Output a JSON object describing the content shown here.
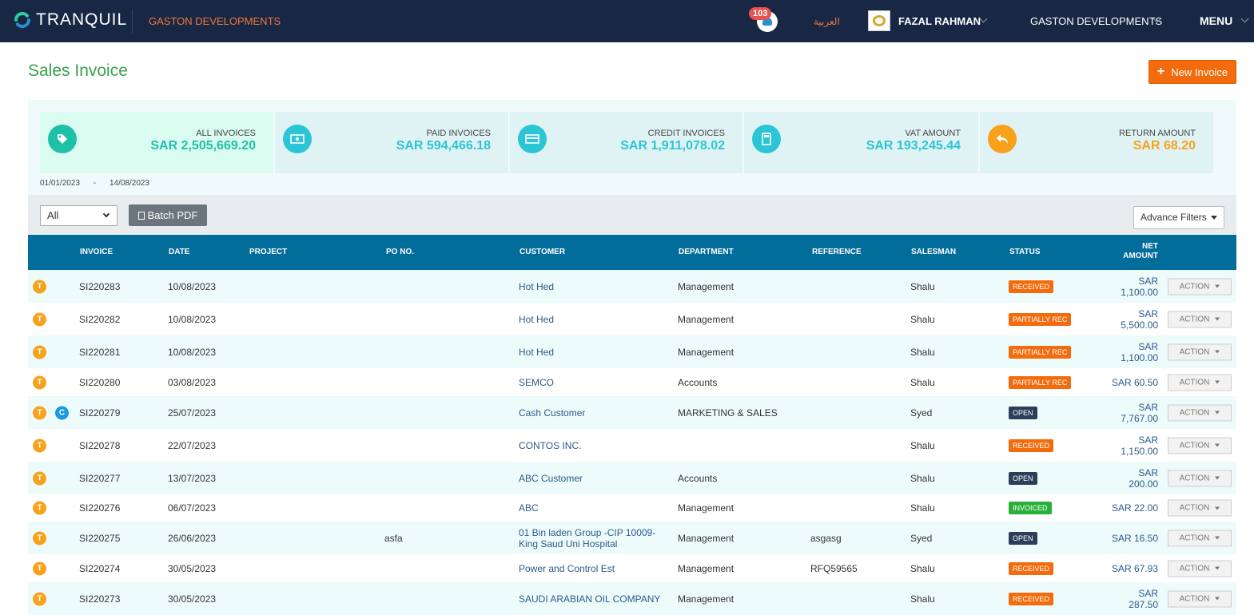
{
  "topbar": {
    "brand": "TRANQUIL",
    "company": "GASTON DEVELOPMENTS",
    "notification_count": "103",
    "language_link": "العربية",
    "user_name": "FAZAL RAHMAN",
    "company_dropdown": "GASTON DEVELOPMENTS",
    "menu": "MENU"
  },
  "page": {
    "title": "Sales Invoice",
    "new_button": "New Invoice"
  },
  "summary": {
    "cards": [
      {
        "label": "ALL INVOICES",
        "value": "SAR 2,505,669.20",
        "icon": "tag-icon",
        "color": "#1fc0a8"
      },
      {
        "label": "PAID INVOICES",
        "value": "SAR 594,466.18",
        "icon": "cash-icon",
        "color": "#2cc5d5"
      },
      {
        "label": "CREDIT INVOICES",
        "value": "SAR 1,911,078.02",
        "icon": "credit-card-icon",
        "color": "#2cc5d5"
      },
      {
        "label": "VAT AMOUNT",
        "value": "SAR 193,245.44",
        "icon": "calculator-icon",
        "color": "#2cc5d5"
      },
      {
        "label": "RETURN AMOUNT",
        "value": "SAR 68.20",
        "icon": "reply-icon",
        "color": "#f7a21a"
      }
    ],
    "date_from": "01/01/2023",
    "date_sep": "-",
    "date_to": "14/08/2023"
  },
  "toolbar": {
    "filter_value": "All",
    "batch_pdf": "Batch PDF",
    "advance_filters": "Advance Filters"
  },
  "table": {
    "headers": {
      "invoice": "INVOICE",
      "date": "DATE",
      "project": "PROJECT",
      "po_no": "PO NO.",
      "customer": "CUSTOMER",
      "department": "DEPARTMENT",
      "reference": "REFERENCE",
      "salesman": "SALESMAN",
      "status": "STATUS",
      "net_amount_1": "NET",
      "net_amount_2": "AMOUNT"
    },
    "action_label": "ACTION",
    "type_badge": "T",
    "cash_badge": "C",
    "rows": [
      {
        "invoice": "SI220283",
        "date": "10/08/2023",
        "project": "",
        "po": "",
        "customer": "Hot Hed",
        "customer2": "",
        "department": "Management",
        "reference": "",
        "salesman": "Shalu",
        "status": "RECEIVED",
        "status_type": "received",
        "net1": "SAR",
        "net2": "1,100.00",
        "cash": false
      },
      {
        "invoice": "SI220282",
        "date": "10/08/2023",
        "project": "",
        "po": "",
        "customer": "Hot Hed",
        "customer2": "",
        "department": "Management",
        "reference": "",
        "salesman": "Shalu",
        "status": "PARTIALLY REC",
        "status_type": "partial",
        "net1": "SAR",
        "net2": "5,500.00",
        "cash": false
      },
      {
        "invoice": "SI220281",
        "date": "10/08/2023",
        "project": "",
        "po": "",
        "customer": "Hot Hed",
        "customer2": "",
        "department": "Management",
        "reference": "",
        "salesman": "Shalu",
        "status": "PARTIALLY REC",
        "status_type": "partial",
        "net1": "SAR",
        "net2": "1,100.00",
        "cash": false
      },
      {
        "invoice": "SI220280",
        "date": "03/08/2023",
        "project": "",
        "po": "",
        "customer": "SEMCO",
        "customer2": "",
        "department": "Accounts",
        "reference": "",
        "salesman": "Shalu",
        "status": "PARTIALLY REC",
        "status_type": "partial",
        "net1": "SAR 60.50",
        "net2": "",
        "cash": false
      },
      {
        "invoice": "SI220279",
        "date": "25/07/2023",
        "project": "",
        "po": "",
        "customer": "Cash Customer",
        "customer2": "",
        "department": "MARKETING & SALES",
        "reference": "",
        "salesman": "Syed",
        "status": "OPEN",
        "status_type": "open",
        "net1": "SAR",
        "net2": "7,767.00",
        "cash": true
      },
      {
        "invoice": "SI220278",
        "date": "22/07/2023",
        "project": "",
        "po": "",
        "customer": "CONTOS INC.",
        "customer2": "",
        "department": "",
        "reference": "",
        "salesman": "Shalu",
        "status": "RECEIVED",
        "status_type": "received",
        "net1": "SAR",
        "net2": "1,150.00",
        "cash": false
      },
      {
        "invoice": "SI220277",
        "date": "13/07/2023",
        "project": "",
        "po": "",
        "customer": "ABC Customer",
        "customer2": "",
        "department": "Accounts",
        "reference": "",
        "salesman": "Shalu",
        "status": "OPEN",
        "status_type": "open",
        "net1": "SAR",
        "net2": "200.00",
        "cash": false
      },
      {
        "invoice": "SI220276",
        "date": "06/07/2023",
        "project": "",
        "po": "",
        "customer": "ABC",
        "customer2": "",
        "department": "Management",
        "reference": "",
        "salesman": "Shalu",
        "status": "INVOICED",
        "status_type": "invoiced",
        "net1": "SAR 22.00",
        "net2": "",
        "cash": false
      },
      {
        "invoice": "SI220275",
        "date": "26/06/2023",
        "project": "",
        "po": "asfa",
        "customer": "01 Bin laden Group -CIP 10009-",
        "customer2": "King Saud Uni Hospital",
        "department": "Management",
        "reference": "asgasg",
        "salesman": "Syed",
        "status": "OPEN",
        "status_type": "open",
        "net1": "SAR 16.50",
        "net2": "",
        "cash": false
      },
      {
        "invoice": "SI220274",
        "date": "30/05/2023",
        "project": "",
        "po": "",
        "customer": "Power and Control Est",
        "customer2": "",
        "department": "Management",
        "reference": "RFQ59565",
        "salesman": "Shalu",
        "status": "RECEIVED",
        "status_type": "received",
        "net1": "SAR 67.93",
        "net2": "",
        "cash": false
      },
      {
        "invoice": "SI220273",
        "date": "30/05/2023",
        "project": "",
        "po": "",
        "customer": "SAUDI ARABIAN OIL COMPANY",
        "customer2": "",
        "department": "Management",
        "reference": "",
        "salesman": "Shalu",
        "status": "RECEIVED",
        "status_type": "received",
        "net1": "SAR",
        "net2": "287.50",
        "cash": false
      }
    ]
  }
}
